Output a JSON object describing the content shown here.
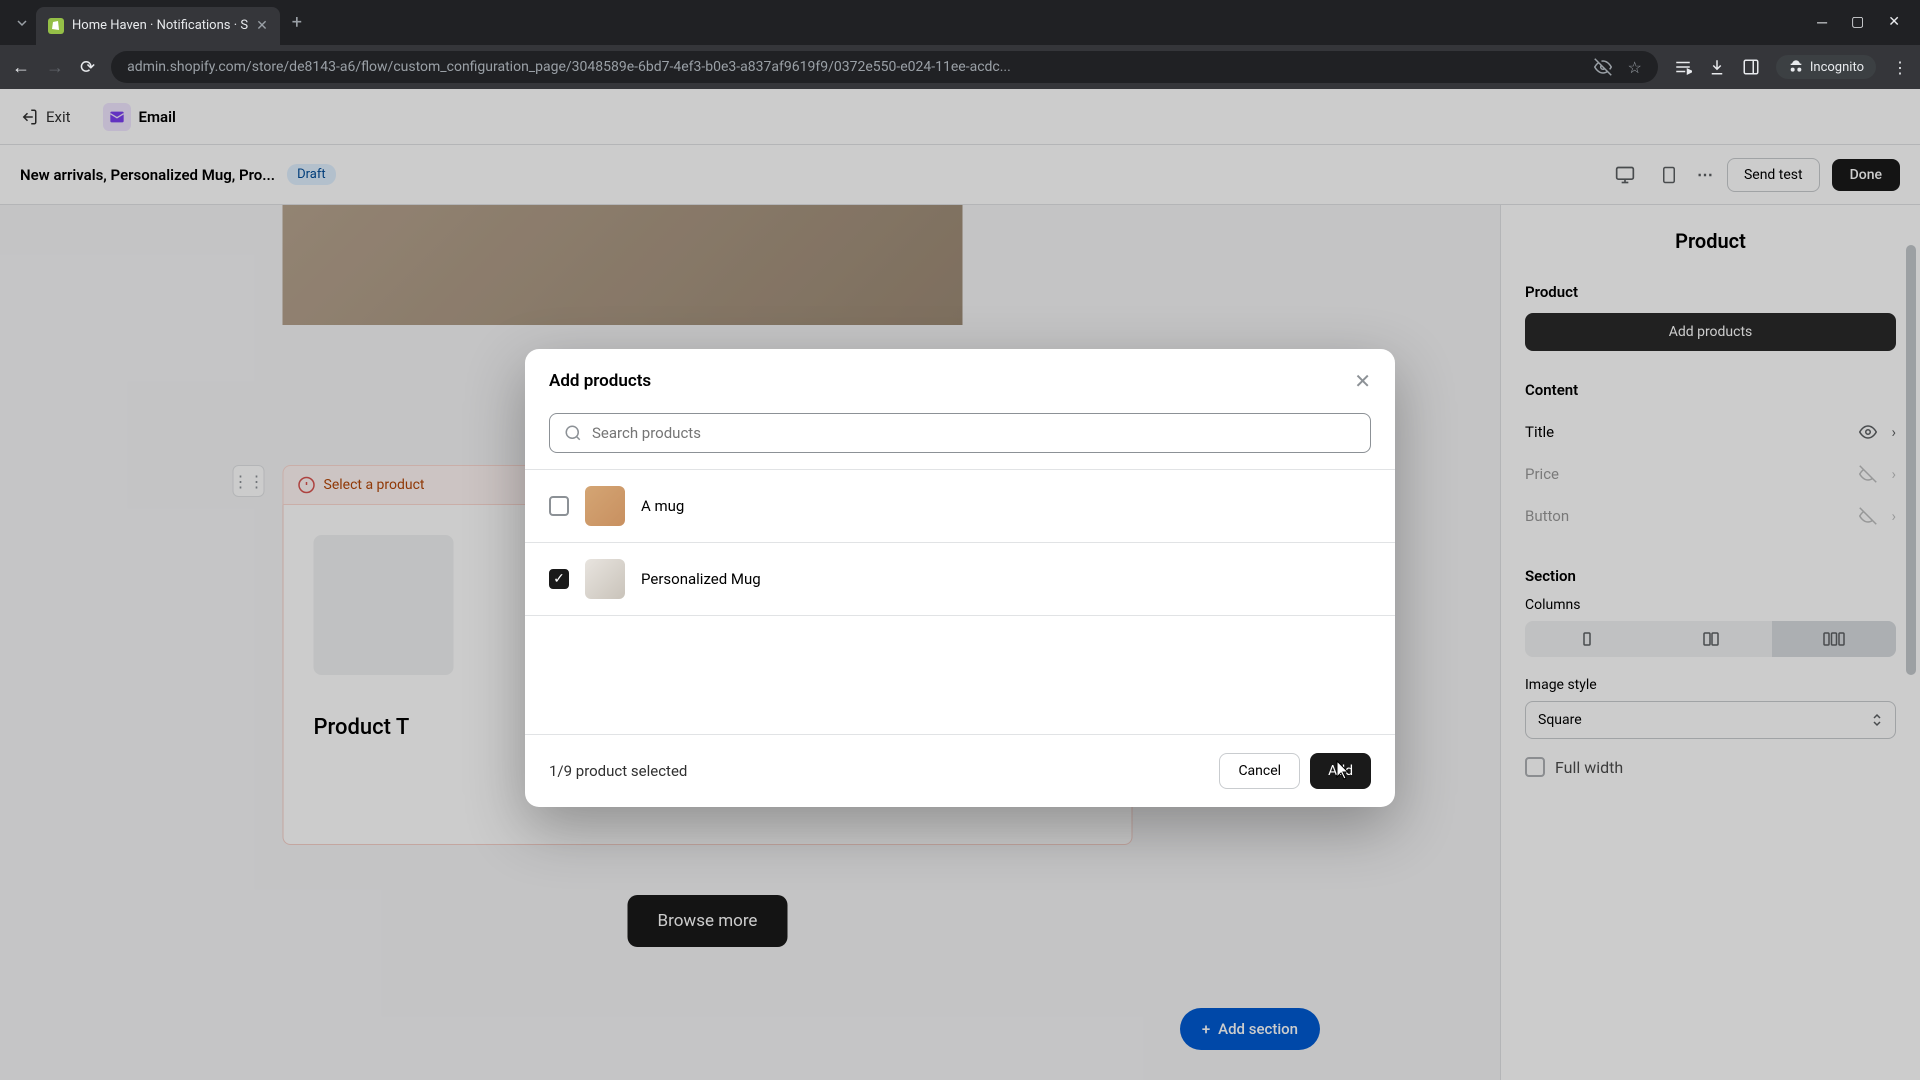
{
  "browser": {
    "tab_title": "Home Haven · Notifications · S",
    "url": "admin.shopify.com/store/de8143-a6/flow/custom_configuration_page/3048589e-6bd7-4ef3-b0e3-a837af9619f9/0372e550-e024-11ee-acdc...",
    "incognito_label": "Incognito"
  },
  "app_header": {
    "exit_label": "Exit",
    "email_label": "Email"
  },
  "sub_header": {
    "campaign_title": "New arrivals, Personalized Mug, Pro...",
    "draft_label": "Draft",
    "send_test_label": "Send test",
    "done_label": "Done"
  },
  "canvas": {
    "select_product_label": "Select a product",
    "product_title_label": "Product T",
    "browse_more_label": "Browse more",
    "add_section_label": "Add section"
  },
  "right_panel": {
    "title": "Product",
    "product_section_label": "Product",
    "add_products_label": "Add products",
    "content_section_label": "Content",
    "content_items": [
      {
        "label": "Title",
        "visible": true
      },
      {
        "label": "Price",
        "visible": false
      },
      {
        "label": "Button",
        "visible": false
      }
    ],
    "section_label": "Section",
    "columns_label": "Columns",
    "image_style_label": "Image style",
    "image_style_value": "Square",
    "full_width_label": "Full width"
  },
  "modal": {
    "title": "Add products",
    "search_placeholder": "Search products",
    "products": [
      {
        "name": "A mug",
        "checked": false
      },
      {
        "name": "Personalized Mug",
        "checked": true
      }
    ],
    "selection_count": "1/9 product selected",
    "cancel_label": "Cancel",
    "add_label": "Add"
  }
}
